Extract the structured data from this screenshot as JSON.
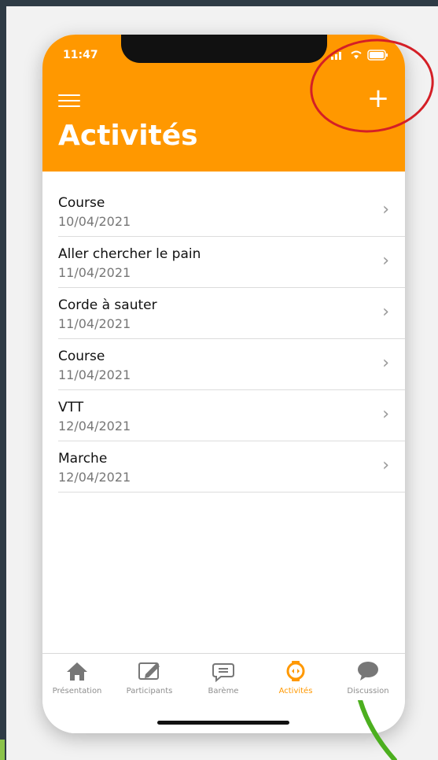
{
  "status_bar": {
    "time": "11:47"
  },
  "header": {
    "title": "Activités"
  },
  "activities": [
    {
      "name": "Course",
      "date": "10/04/2021"
    },
    {
      "name": "Aller chercher le pain",
      "date": "11/04/2021"
    },
    {
      "name": "Corde à sauter",
      "date": "11/04/2021"
    },
    {
      "name": "Course",
      "date": "11/04/2021"
    },
    {
      "name": "VTT",
      "date": "12/04/2021"
    },
    {
      "name": "Marche",
      "date": "12/04/2021"
    }
  ],
  "tabs": [
    {
      "label": "Présentation",
      "icon": "home-icon"
    },
    {
      "label": "Participants",
      "icon": "edit-icon"
    },
    {
      "label": "Barème",
      "icon": "chat-list-icon"
    },
    {
      "label": "Activités",
      "icon": "activity-icon",
      "active": true
    },
    {
      "label": "Discussion",
      "icon": "discussion-icon"
    }
  ],
  "colors": {
    "accent": "#ff9800",
    "annotation_red": "#d41f26",
    "annotation_green": "#4caf1f"
  }
}
